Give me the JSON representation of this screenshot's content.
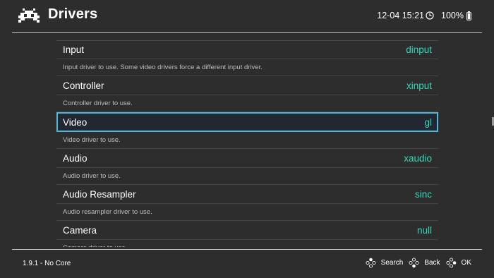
{
  "header": {
    "title": "Drivers",
    "datetime": "12-04 15:21",
    "battery": "100%"
  },
  "menu": {
    "items": [
      {
        "label": "Input",
        "value": "dinput",
        "description": "Input driver to use. Some video drivers force a different input driver."
      },
      {
        "label": "Controller",
        "value": "xinput",
        "description": "Controller driver to use."
      },
      {
        "label": "Video",
        "value": "gl",
        "description": "Video driver to use.",
        "selected": true
      },
      {
        "label": "Audio",
        "value": "xaudio",
        "description": "Audio driver to use."
      },
      {
        "label": "Audio Resampler",
        "value": "sinc",
        "description": "Audio resampler driver to use."
      },
      {
        "label": "Camera",
        "value": "null",
        "description": "Camera driver to use."
      }
    ]
  },
  "footer": {
    "version": "1.9.1 - No Core",
    "hints": {
      "search": "Search",
      "back": "Back",
      "ok": "OK"
    }
  },
  "colors": {
    "background": "#2d2d2d",
    "value_accent": "#34d7b8",
    "selection_border": "#4fb7dc",
    "selection_fill": "#222831"
  }
}
